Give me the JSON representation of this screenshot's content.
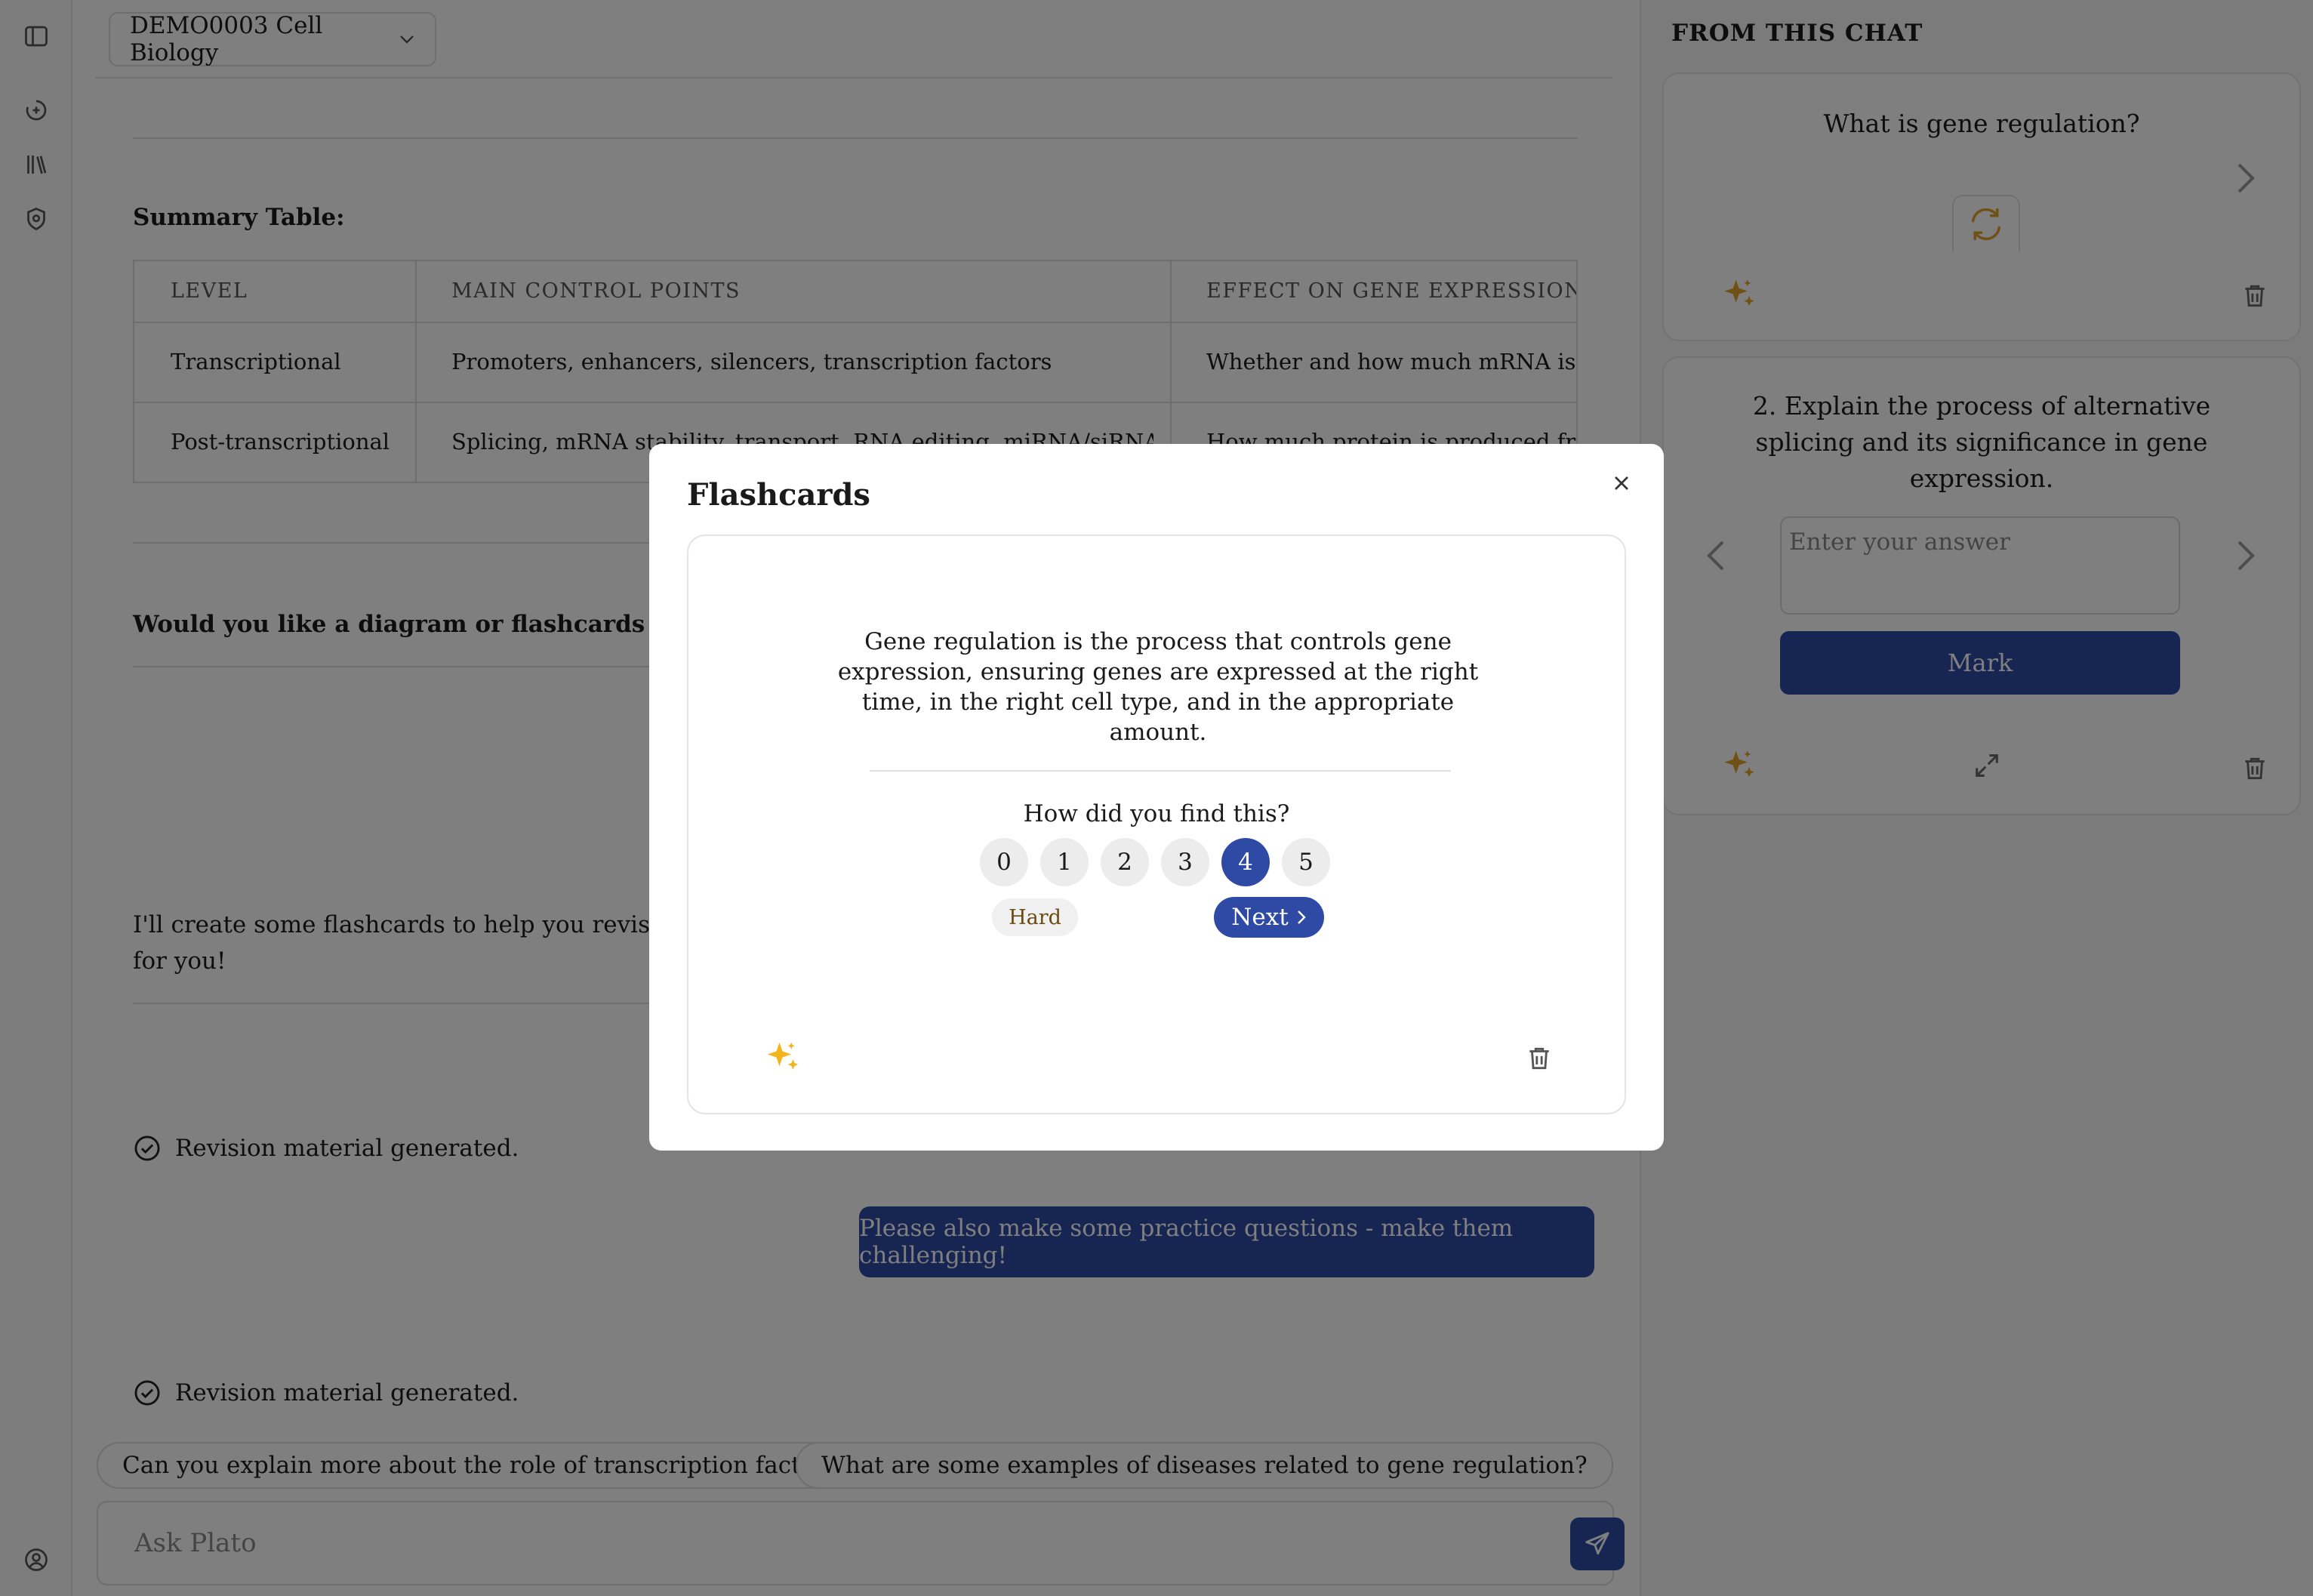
{
  "header": {
    "course_name": "DEMO0003 Cell Biology"
  },
  "conversation": {
    "summary_title": "Summary Table:",
    "table": {
      "headers": [
        "LEVEL",
        "MAIN CONTROL POINTS",
        "EFFECT ON GENE EXPRESSION"
      ],
      "rows": [
        [
          "Transcriptional",
          "Promoters, enhancers, silencers, transcription factors",
          "Whether and how much mRNA is m"
        ],
        [
          "Post-transcriptional",
          "Splicing, mRNA stability, transport, RNA editing, miRNA/siRNA",
          "How much protein is produced from"
        ]
      ]
    },
    "followup_question": "Would you like a diagram or flashcards to help",
    "assistant_line1": "I'll create some flashcards to help you revise trans",
    "assistant_line2": "for you!",
    "status_1": "Revision material generated.",
    "user_message": "Please also make some practice questions - make them challenging!",
    "status_2": "Revision material generated."
  },
  "suggestions": [
    "Can you explain more about the role of transcription factors?",
    "What are some examples of diseases related to gene regulation?"
  ],
  "composer": {
    "placeholder": "Ask Plato"
  },
  "right_panel": {
    "title": "FROM THIS CHAT",
    "flashcard_question": "What is gene regulation?",
    "practice_question": "2. Explain the process of alternative splicing and its significance in gene expression.",
    "answer_placeholder": "Enter your answer",
    "mark_label": "Mark"
  },
  "modal": {
    "title": "Flashcards",
    "answer": "Gene regulation is the process that controls gene expression, ensuring genes are expressed at the right time, in the right cell type, and in the appropriate amount.",
    "prompt": "How did you find this?",
    "ratings": [
      "0",
      "1",
      "2",
      "3",
      "4",
      "5"
    ],
    "selected_rating": "4",
    "hard_label": "Hard",
    "next_label": "Next"
  },
  "colors": {
    "accent": "#2e4aa5",
    "sparkle": "#f2b51c",
    "overlay": "rgba(0,0,0,0.5)"
  },
  "icons": {
    "rail": [
      "sidebar-toggle-icon",
      "new-chat-icon",
      "library-icon",
      "shield-icon",
      "account-icon"
    ],
    "modal": [
      "close-icon",
      "sparkle-icon",
      "trash-icon"
    ]
  }
}
